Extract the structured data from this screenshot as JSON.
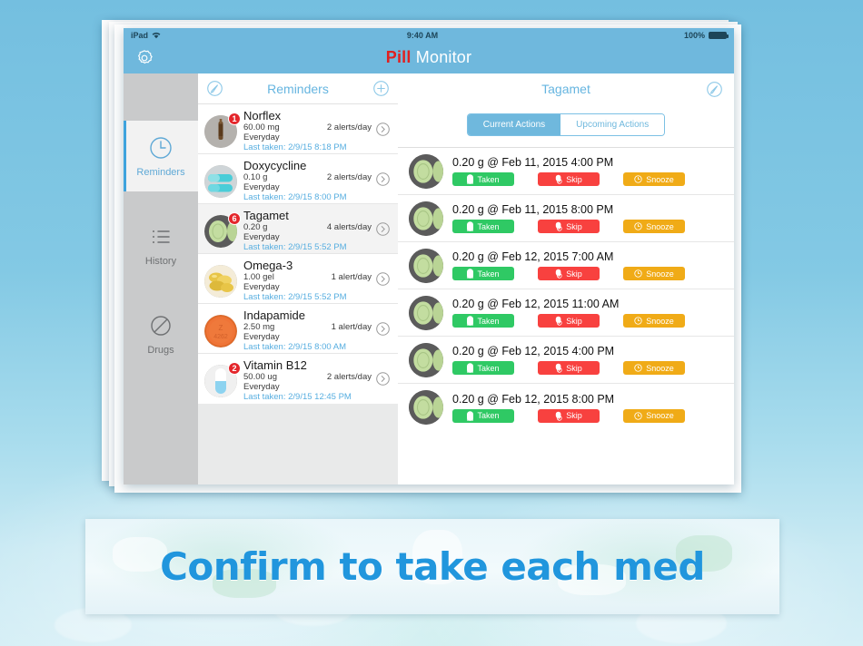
{
  "status_bar": {
    "device": "iPad",
    "wifi_icon": "wifi-icon",
    "time": "9:40 AM",
    "battery_pct": "100%"
  },
  "nav": {
    "gear_icon": "gear-icon",
    "title_accent": "P",
    "title_accent2": "ill",
    "title_rest": " Monitor"
  },
  "sidebar": {
    "items": [
      {
        "label": "Reminders",
        "icon": "clock-icon",
        "active": true
      },
      {
        "label": "History",
        "icon": "list-icon",
        "active": false
      },
      {
        "label": "Drugs",
        "icon": "pill-circle-icon",
        "active": false
      }
    ]
  },
  "reminders_panel": {
    "header": {
      "edit_icon": "edit-pencil-circle-icon",
      "title": "Reminders",
      "add_icon": "plus-circle-icon"
    },
    "items": [
      {
        "name": "Norflex",
        "dose": "60.00 mg",
        "alerts": "2 alerts/day",
        "frequency": "Everyday",
        "last_taken": "Last taken: 2/9/15 8:18 PM",
        "badge": "1",
        "thumb": "ampoule-thumb",
        "chevron_icon": "chevron-right-circle-icon"
      },
      {
        "name": "Doxycycline",
        "dose": "0.10 g",
        "alerts": "2 alerts/day",
        "frequency": "Everyday",
        "last_taken": "Last taken: 2/9/15 8:00 PM",
        "badge": "",
        "thumb": "blue-capsules-thumb",
        "chevron_icon": "chevron-right-circle-icon"
      },
      {
        "name": "Tagamet",
        "dose": "0.20 g",
        "alerts": "4 alerts/day",
        "frequency": "Everyday",
        "last_taken": "Last taken: 2/9/15 5:52 PM",
        "badge": "6",
        "thumb": "green-tablet-thumb",
        "chevron_icon": "chevron-right-circle-icon"
      },
      {
        "name": "Omega-3",
        "dose": "1.00 gel",
        "alerts": "1 alert/day",
        "frequency": "Everyday",
        "last_taken": "Last taken: 2/9/15 5:52 PM",
        "badge": "",
        "thumb": "gold-gelcaps-thumb",
        "chevron_icon": "chevron-right-circle-icon"
      },
      {
        "name": "Indapamide",
        "dose": "2.50 mg",
        "alerts": "1 alert/day",
        "frequency": "Everyday",
        "last_taken": "Last taken: 2/9/15 8:00 AM",
        "badge": "",
        "thumb": "orange-tablet-thumb",
        "chevron_icon": "chevron-right-circle-icon"
      },
      {
        "name": "Vitamin B12",
        "dose": "50.00 ug",
        "alerts": "2 alerts/day",
        "frequency": "Everyday",
        "last_taken": "Last taken: 2/9/15 12:45 PM",
        "badge": "2",
        "thumb": "blue-white-capsule-thumb",
        "chevron_icon": "chevron-right-circle-icon"
      }
    ]
  },
  "detail_panel": {
    "title": "Tagamet",
    "edit_icon": "edit-pencil-circle-icon",
    "tabs": [
      {
        "label": "Current Actions",
        "selected": true
      },
      {
        "label": "Upcoming Actions",
        "selected": false
      }
    ],
    "buttons": {
      "taken": "Taken",
      "skip": "Skip",
      "snooze": "Snooze",
      "taken_icon": "pill-icon",
      "skip_icon": "pill-slash-icon",
      "snooze_icon": "clock-icon"
    },
    "actions": [
      {
        "title": "0.20 g @ Feb 11, 2015 4:00 PM"
      },
      {
        "title": "0.20 g @ Feb 11, 2015 8:00 PM"
      },
      {
        "title": "0.20 g @ Feb 12, 2015 7:00 AM"
      },
      {
        "title": "0.20 g @ Feb 12, 2015 11:00 AM"
      },
      {
        "title": "0.20 g @ Feb 12, 2015 4:00 PM"
      },
      {
        "title": "0.20 g @ Feb 12, 2015 8:00 PM"
      }
    ]
  },
  "caption": {
    "text": "Confirm to take each med"
  },
  "colors": {
    "brand_blue": "#6fb8dd",
    "accent_red": "#e02020",
    "link_blue": "#57aee0",
    "taken_green": "#2fc964",
    "skip_red": "#f8413f",
    "snooze_amber": "#f0ab17",
    "badge_red": "#e4262b",
    "page_bg": "#7bc2e0"
  }
}
